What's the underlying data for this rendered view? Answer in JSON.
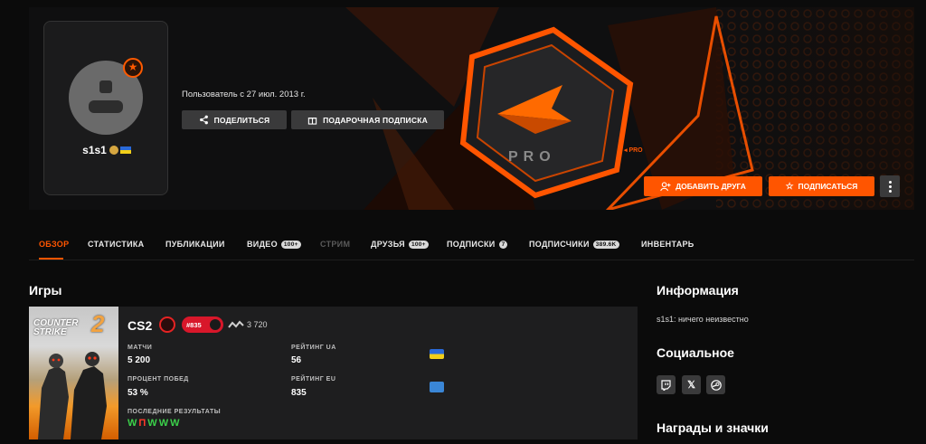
{
  "profile": {
    "nickname": "s1s1",
    "level_icon": "star-icon",
    "member_since": "Пользователь с 27 июл. 2013 г."
  },
  "banner": {
    "badge_text": "PRO",
    "badge_small": "◂ PRO"
  },
  "actions": {
    "share": "ПОДЕЛИТЬСЯ",
    "gift": "ПОДАРОЧНАЯ ПОДПИСКА",
    "add_friend": "ДОБАВИТЬ ДРУГА",
    "subscribe": "ПОДПИСАТЬСЯ"
  },
  "tabs": [
    {
      "label": "ОБЗОР",
      "badge": ""
    },
    {
      "label": "СТАТИСТИКА",
      "badge": ""
    },
    {
      "label": "ПУБЛИКАЦИИ",
      "badge": ""
    },
    {
      "label": "ВИДЕО",
      "badge": "100+"
    },
    {
      "label": "СТРИМ",
      "badge": ""
    },
    {
      "label": "ДРУЗЬЯ",
      "badge": "100+"
    },
    {
      "label": "ПОДПИСКИ",
      "badge": "7"
    },
    {
      "label": "ПОДПИСЧИКИ",
      "badge": "389.6K"
    },
    {
      "label": "ИНВЕНТАРЬ",
      "badge": ""
    }
  ],
  "games": {
    "title": "Игры",
    "cover_logo_line1": "COUNTER",
    "cover_logo_line2": "STRIKE",
    "cover_logo_num": "2",
    "game_name": "CS2",
    "rank": "#835",
    "elo": "3 720",
    "stats": {
      "matches_label": "МАТЧИ",
      "matches_value": "5 200",
      "winrate_label": "ПРОЦЕНТ ПОБЕД",
      "winrate_value": "53 %",
      "rating_ua_label": "РЕЙТИНГ UA",
      "rating_ua_value": "56",
      "rating_eu_label": "РЕЙТИНГ EU",
      "rating_eu_value": "835",
      "recent_label": "ПОСЛЕДНИЕ РЕЗУЛЬТАТЫ",
      "recent": [
        "W",
        "П",
        "W",
        "W",
        "W"
      ]
    }
  },
  "info": {
    "title": "Информация",
    "text": "s1s1: ничего неизвестно"
  },
  "social": {
    "title": "Социальное",
    "icons": [
      "twitch-icon",
      "x-icon",
      "steam-icon"
    ]
  },
  "awards": {
    "title": "Награды и значки"
  },
  "colors": {
    "accent": "#ff5500",
    "background": "#0b0b0b",
    "win": "#3bd14a",
    "loss": "#ff3a2a"
  }
}
